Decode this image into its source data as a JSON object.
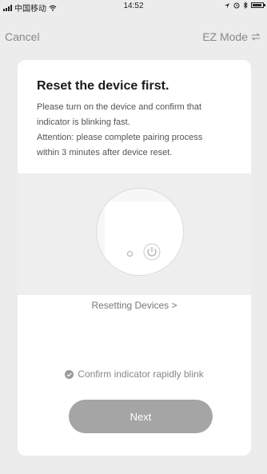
{
  "status_bar": {
    "carrier": "中国移动",
    "time": "14:52",
    "battery_level": 0.9,
    "icons": [
      "signal-icon",
      "wifi-icon",
      "location-icon",
      "alarm-icon",
      "bluetooth-icon",
      "battery-icon"
    ]
  },
  "nav": {
    "cancel_label": "Cancel",
    "mode_label": "EZ Mode",
    "mode_icon": "swap-icon"
  },
  "card": {
    "title": "Reset the device first.",
    "description_lines": [
      "Please turn on the device and confirm that",
      "indicator is blinking fast.",
      "Attention: please complete pairing process",
      "within 3 minutes after device reset."
    ],
    "reset_link_label": "Resetting Devices >",
    "confirm_label": "Confirm indicator rapidly blink",
    "confirm_checked": false,
    "next_label": "Next"
  },
  "colors": {
    "background": "#ececec",
    "card": "#ffffff",
    "button_disabled": "#a5a5a5",
    "illustration_bg": "#eeeeee"
  }
}
